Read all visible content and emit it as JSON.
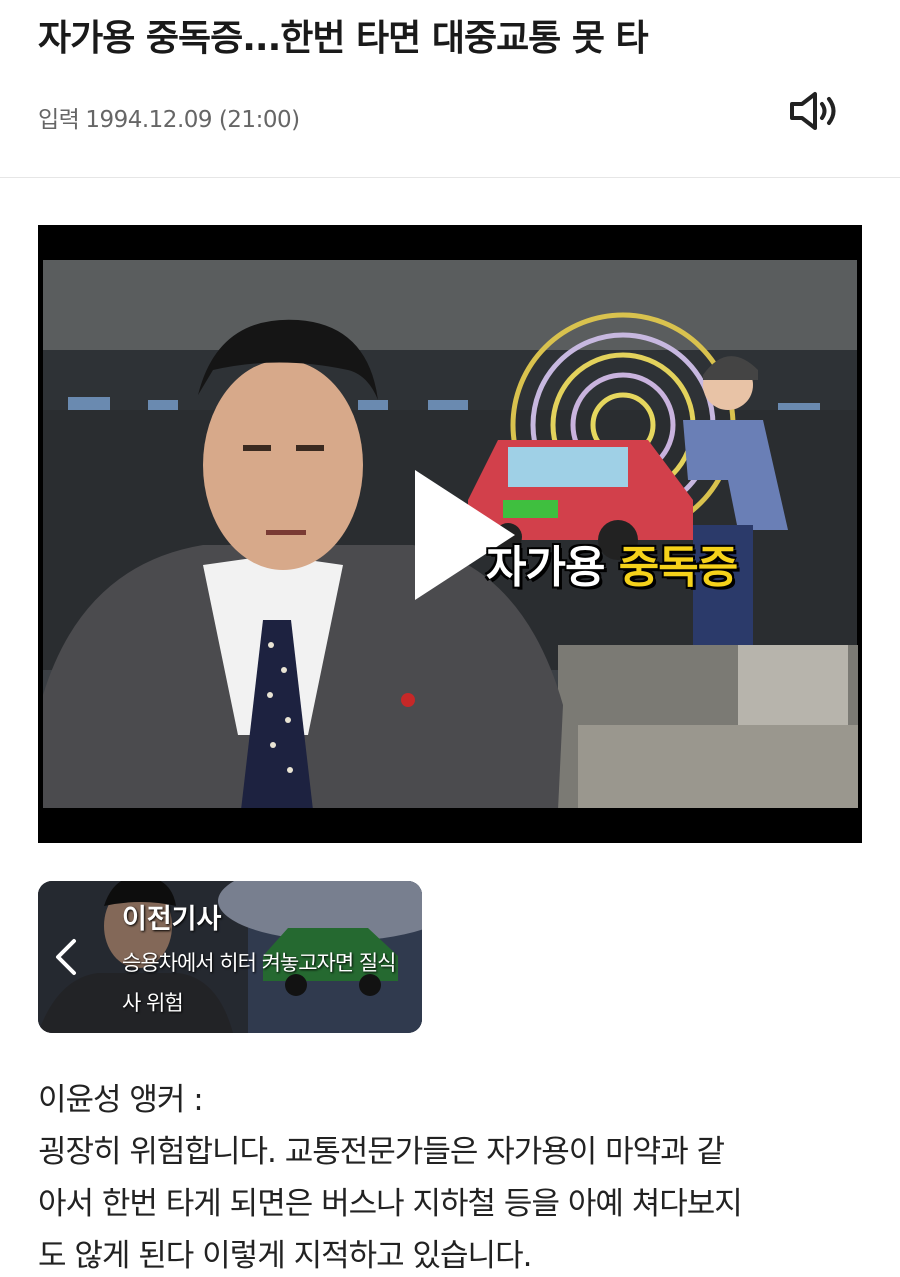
{
  "article": {
    "title": "자가용 중독증...한번 타면 대중교통 못 타",
    "date_label": "입력",
    "date": "1994.12.09 (21:00)"
  },
  "icons": {
    "speaker": "speaker-volume-icon",
    "play": "play-icon",
    "prev_arrow": "chevron-left-icon"
  },
  "video": {
    "caption_part1": "자가용 ",
    "caption_part2": "중독증"
  },
  "previous_article": {
    "label": "이전기사",
    "summary": "승용차에서 히터 켜놓고자면 질식사 위험"
  },
  "body": {
    "lines": [
      "이윤성 앵커 :",
      "굉장히 위험합니다. 교통전문가들은 자가용이 마약과 같",
      "아서 한번 타게 되면은 버스나 지하철 등을 아예 쳐다보지",
      "도 않게 된다 이렇게 지적하고 있습니다."
    ]
  },
  "colors": {
    "caption_highlight": "#f5d21a",
    "text": "#222222",
    "meta": "#666666"
  }
}
